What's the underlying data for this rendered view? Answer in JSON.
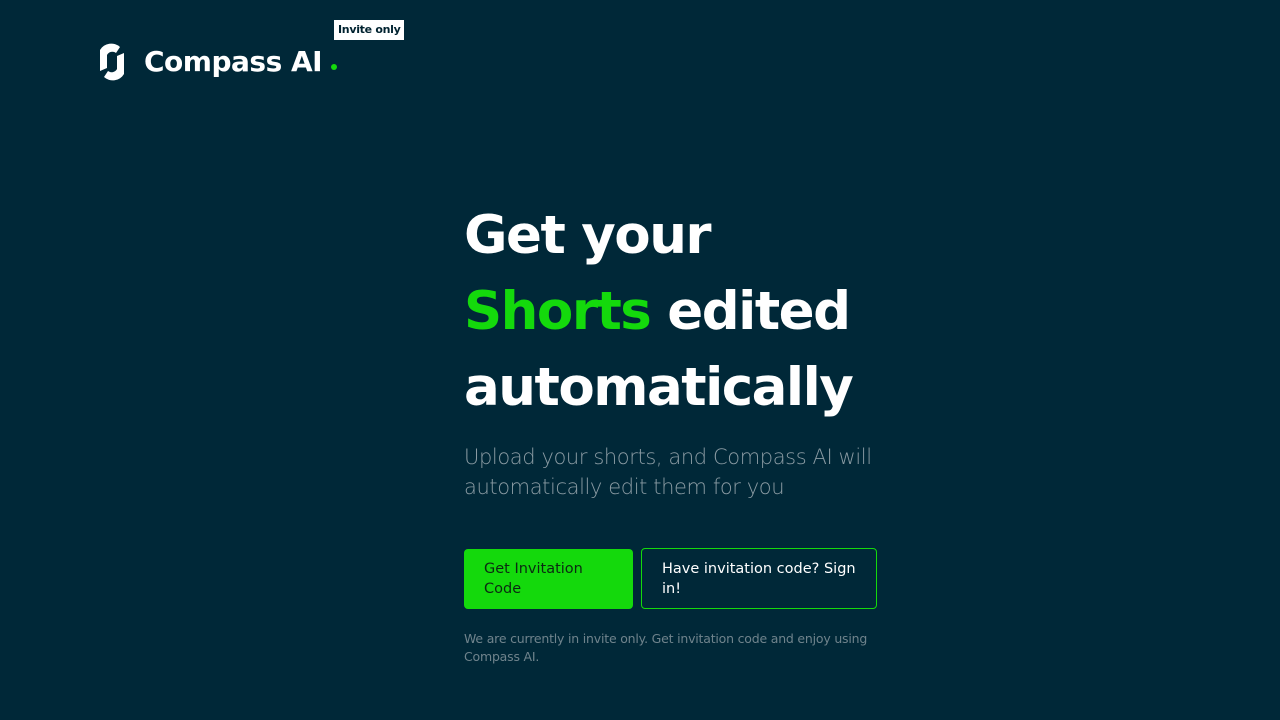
{
  "brand": {
    "name": "Compass AI",
    "badge": "Invite only",
    "accent_color": "#14d90c",
    "background_color": "#002838",
    "logo_icon": "compass-logo-mark"
  },
  "hero": {
    "title_line1": "Get your",
    "title_accent": "Shorts",
    "title_line2_rest": " edited",
    "title_line3": "automatically",
    "subtitle": "Upload your shorts, and Compass AI will automatically edit them for you"
  },
  "actions": {
    "primary_label": "Get Invitation Code",
    "secondary_label": "Have invitation code? Sign in!"
  },
  "note": "We are currently in invite only. Get invitation code and enjoy using Compass AI."
}
